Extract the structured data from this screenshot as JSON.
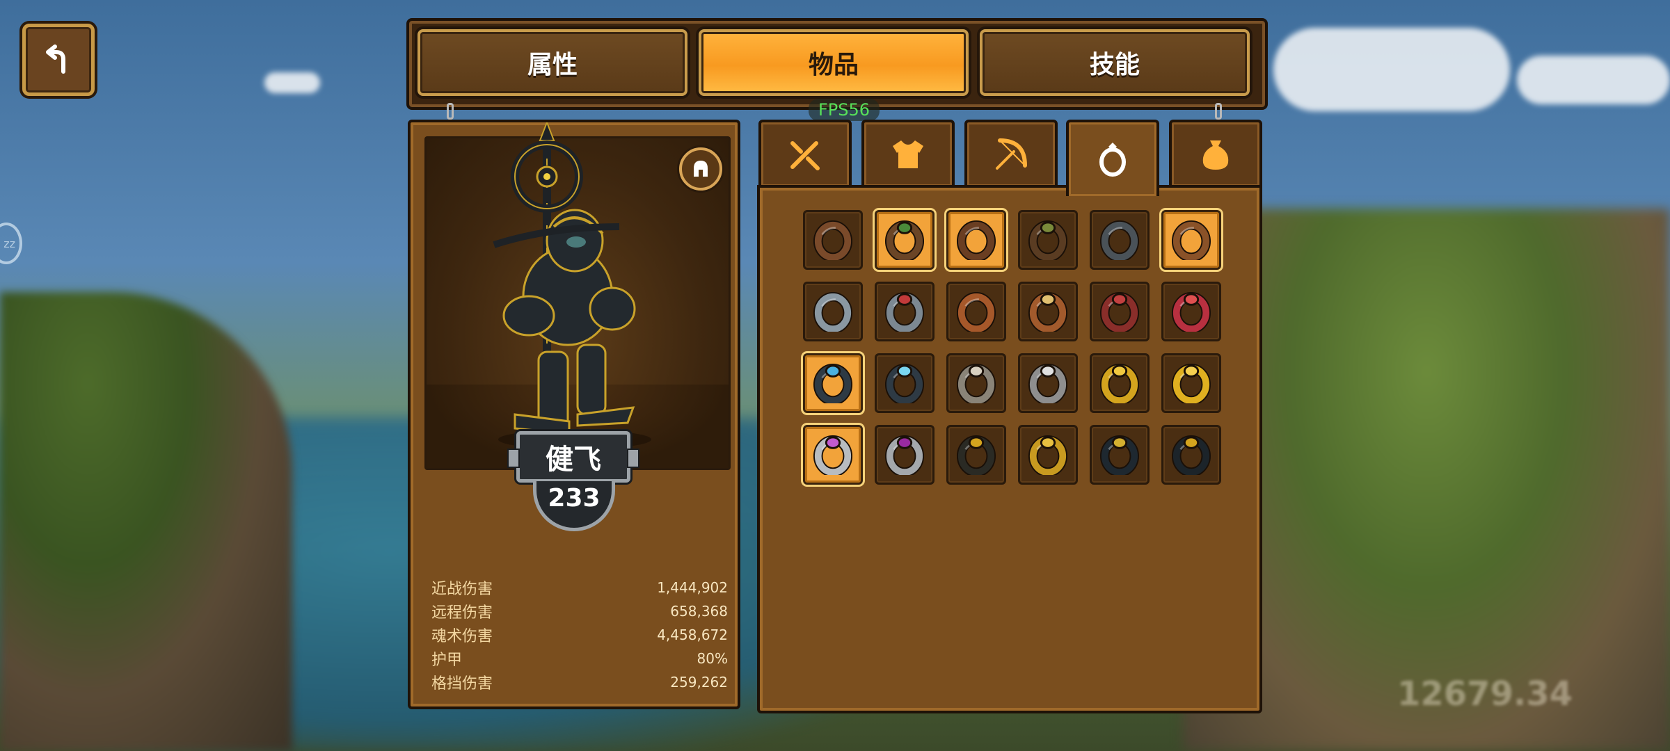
{
  "header": {
    "back_icon": "back-arrow-icon",
    "tabs": [
      {
        "label": "属性",
        "active": false
      },
      {
        "label": "物品",
        "active": true
      },
      {
        "label": "技能",
        "active": false
      }
    ],
    "fps_text": "FPS56"
  },
  "character": {
    "name": "健飞",
    "level": "233",
    "helmet_toggle_icon": "helmet-icon",
    "stats": [
      {
        "label": "近战伤害",
        "value": "1,444,902"
      },
      {
        "label": "远程伤害",
        "value": "658,368"
      },
      {
        "label": "魂术伤害",
        "value": "4,458,672"
      },
      {
        "label": "护甲",
        "value": "80%"
      },
      {
        "label": "格挡伤害",
        "value": "259,262"
      }
    ]
  },
  "inventory": {
    "categories": [
      {
        "icon": "crossed-swords-icon",
        "active": false
      },
      {
        "icon": "armor-icon",
        "active": false
      },
      {
        "icon": "bow-icon",
        "active": false
      },
      {
        "icon": "ring-icon",
        "active": true
      },
      {
        "icon": "bag-icon",
        "active": false
      }
    ],
    "items": [
      {
        "icon": "ring-icon",
        "variant": "leather",
        "color": "#7a4a2a",
        "gem": "",
        "equipped": false
      },
      {
        "icon": "ring-icon",
        "variant": "leather-green",
        "color": "#6b4526",
        "gem": "#4a8a3a",
        "equipped": true
      },
      {
        "icon": "ring-icon",
        "variant": "leather-braided",
        "color": "#6a3e22",
        "gem": "",
        "equipped": true
      },
      {
        "icon": "ring-icon",
        "variant": "moss",
        "color": "#5a3c22",
        "gem": "#7a8a3a",
        "equipped": false
      },
      {
        "icon": "ring-icon",
        "variant": "steel-band",
        "color": "#4a5258",
        "gem": "",
        "equipped": false
      },
      {
        "icon": "ring-icon",
        "variant": "copper-band",
        "color": "#8a5228",
        "gem": "",
        "equipped": true
      },
      {
        "icon": "ring-icon",
        "variant": "silver",
        "color": "#8a98a2",
        "gem": "",
        "equipped": false
      },
      {
        "icon": "ring-icon",
        "variant": "silver-ruby",
        "color": "#7c8892",
        "gem": "#c23a3a",
        "equipped": false
      },
      {
        "icon": "ring-icon",
        "variant": "copper",
        "color": "#a6582a",
        "gem": "",
        "equipped": false
      },
      {
        "icon": "ring-icon",
        "variant": "copper-studded",
        "color": "#a25a2c",
        "gem": "#e0c070",
        "equipped": false
      },
      {
        "icon": "ring-icon",
        "variant": "red-thorn",
        "color": "#8a2e2a",
        "gem": "#c24040",
        "equipped": false
      },
      {
        "icon": "ring-icon",
        "variant": "crimson-spike",
        "color": "#b83040",
        "gem": "#e05050",
        "equipped": false
      },
      {
        "icon": "ring-icon",
        "variant": "dark-sapphire",
        "color": "#2e3a44",
        "gem": "#4ab0e0",
        "equipped": true
      },
      {
        "icon": "ring-icon",
        "variant": "dark-crystal",
        "color": "#2e3a44",
        "gem": "#7ad6f0",
        "equipped": false
      },
      {
        "icon": "ring-icon",
        "variant": "bone-spike",
        "color": "#8a8478",
        "gem": "#d8d0c0",
        "equipped": false
      },
      {
        "icon": "ring-icon",
        "variant": "silver-spike",
        "color": "#8e8e8e",
        "gem": "#e0e0e0",
        "equipped": false
      },
      {
        "icon": "ring-icon",
        "variant": "gold-signet",
        "color": "#d4a41e",
        "gem": "#f0c840",
        "equipped": false
      },
      {
        "icon": "ring-icon",
        "variant": "gold-seal",
        "color": "#e0b020",
        "gem": "#f6d050",
        "equipped": false
      },
      {
        "icon": "ring-icon",
        "variant": "silver-amethyst",
        "color": "#b8bcc0",
        "gem": "#c25ad0",
        "equipped": true
      },
      {
        "icon": "ring-icon",
        "variant": "silver-purple",
        "color": "#a4a8ac",
        "gem": "#9a2aa0",
        "equipped": false
      },
      {
        "icon": "ring-icon",
        "variant": "gold-black",
        "color": "#2a2a24",
        "gem": "#d4a41e",
        "equipped": false
      },
      {
        "icon": "ring-icon",
        "variant": "gold-crown",
        "color": "#c89a20",
        "gem": "#e8c040",
        "equipped": false
      },
      {
        "icon": "ring-icon",
        "variant": "obsidian-dots",
        "color": "#1e2830",
        "gem": "#d4b030",
        "equipped": false
      },
      {
        "icon": "ring-icon",
        "variant": "obsidian-gold",
        "color": "#1c242a",
        "gem": "#d4a41e",
        "equipped": false
      }
    ]
  },
  "colors": {
    "panel": "#7a4e1e",
    "frame": "#1e1208",
    "active_tab": "#f89a20",
    "equipped_slot": "#f2a33a",
    "fps_green": "#57e05a"
  },
  "background": {
    "blurred_gold_text": "12679.34"
  }
}
